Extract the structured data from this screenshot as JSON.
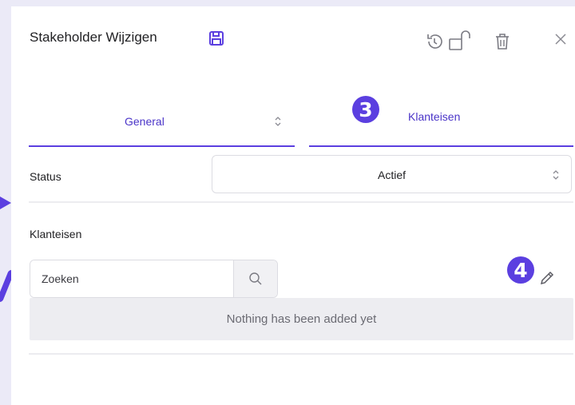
{
  "dialog": {
    "title": "Stakeholder Wijzigen",
    "icons": [
      "save-icon",
      "history-icon",
      "unlock-icon",
      "trash-icon",
      "close-icon"
    ]
  },
  "tabs": [
    {
      "label": "General",
      "active": true
    },
    {
      "label": "Klanteisen",
      "active": false
    }
  ],
  "annotations": {
    "badge_3": "3",
    "badge_4": "4"
  },
  "status": {
    "label": "Status",
    "value": "Actief"
  },
  "klanteisen": {
    "label": "Klanteisen",
    "search_placeholder": "Zoeken",
    "empty_text": "Nothing has been added yet"
  },
  "colors": {
    "accent": "#5b3fe0",
    "background": "#ebeaf7",
    "empty_bg": "#ededf1"
  }
}
